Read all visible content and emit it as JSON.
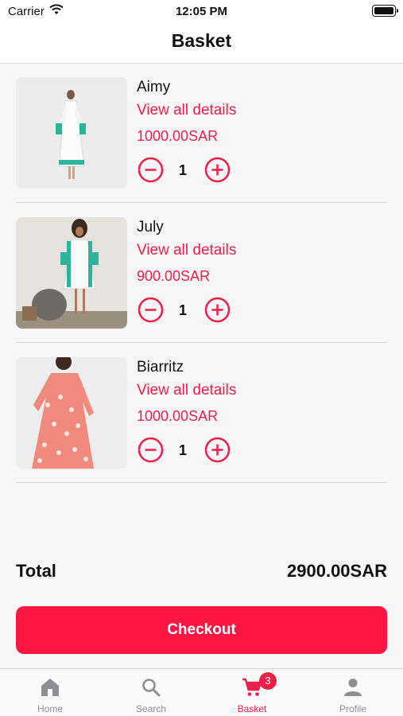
{
  "status": {
    "carrier": "Carrier",
    "time": "12:05 PM"
  },
  "header": {
    "title": "Basket"
  },
  "items": [
    {
      "name": "Aimy",
      "link": "View all details",
      "price": "1000.00SAR",
      "qty": "1"
    },
    {
      "name": "July",
      "link": "View all details",
      "price": "900.00SAR",
      "qty": "1"
    },
    {
      "name": "Biarritz",
      "link": "View all details",
      "price": "1000.00SAR",
      "qty": "1"
    }
  ],
  "summary": {
    "total_label": "Total",
    "total_value": "2900.00SAR"
  },
  "checkout": {
    "label": "Checkout"
  },
  "tabs": [
    {
      "label": "Home",
      "icon": "home-icon"
    },
    {
      "label": "Search",
      "icon": "search-icon"
    },
    {
      "label": "Basket",
      "icon": "cart-icon",
      "badge": "3"
    },
    {
      "label": "Profile",
      "icon": "person-icon"
    }
  ],
  "colors": {
    "accent": "#ee1f4a",
    "checkout": "#fc1742",
    "tab_inactive": "#8e8e93"
  }
}
